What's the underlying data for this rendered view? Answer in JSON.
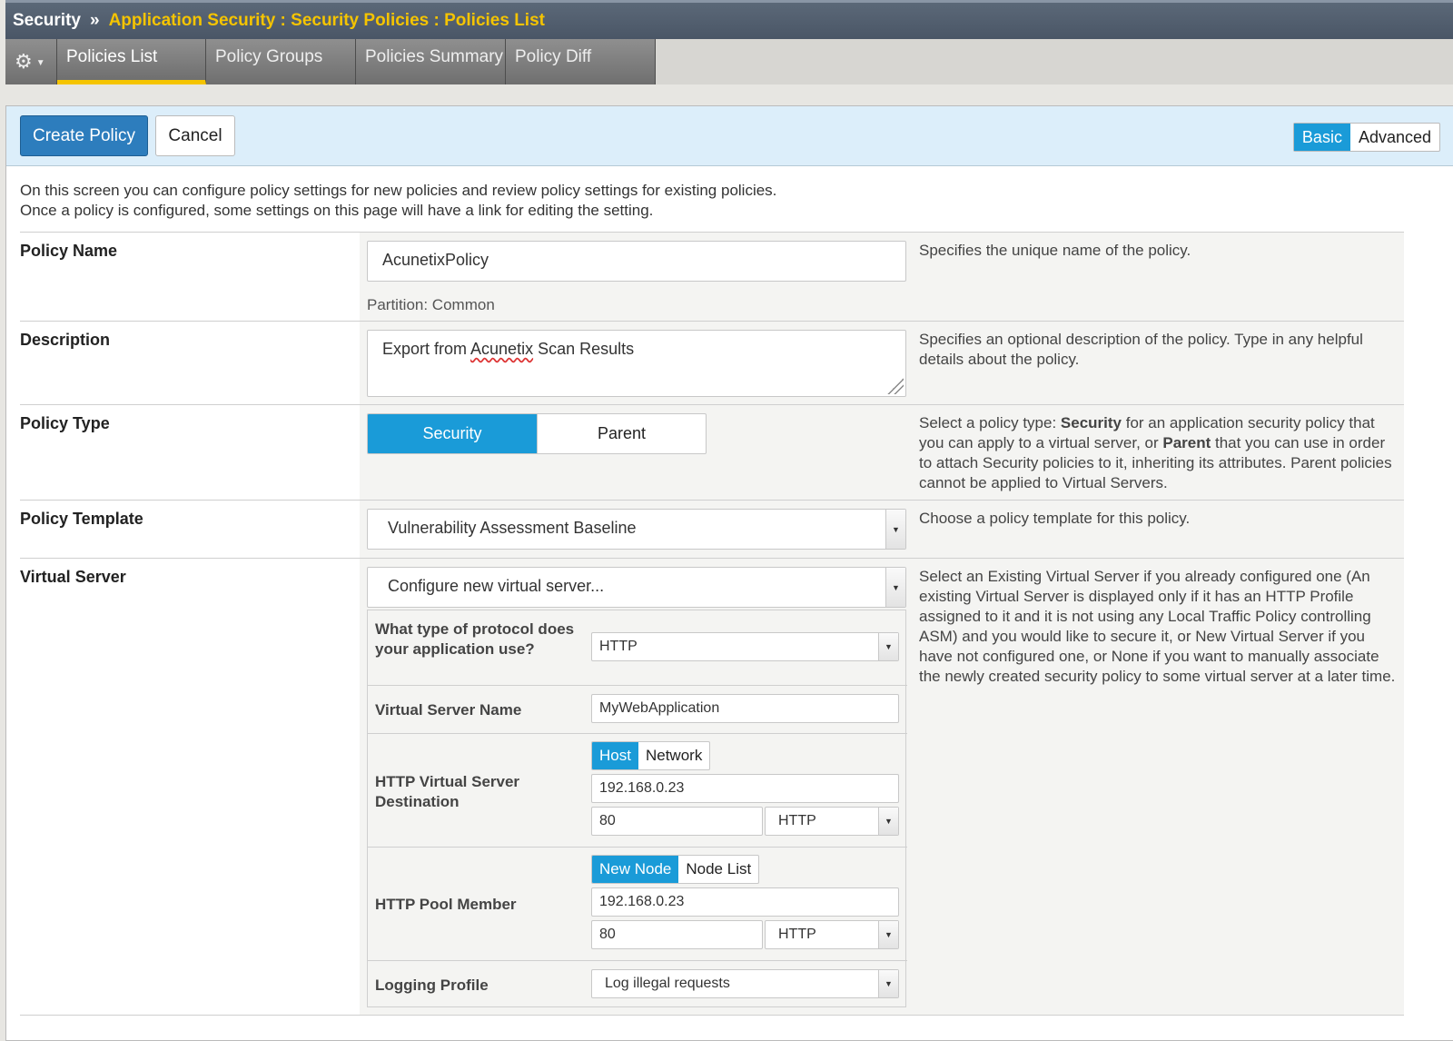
{
  "breadcrumb": {
    "root": "Security",
    "separator": "»",
    "path": "Application Security : Security Policies : Policies List"
  },
  "tabs": [
    "Policies List",
    "Policy Groups",
    "Policies Summary",
    "Policy Diff"
  ],
  "icons": {
    "gear": "gear-icon",
    "caret": "caret-down-icon"
  },
  "toolbar": {
    "create_label": "Create Policy",
    "cancel_label": "Cancel",
    "mode_basic": "Basic",
    "mode_advanced": "Advanced"
  },
  "intro": {
    "line1": "On this screen you can configure policy settings for new policies and review policy settings for existing policies.",
    "line2": "Once a policy is configured, some settings on this page will have a link for editing the setting."
  },
  "policy_name": {
    "label": "Policy Name",
    "value": "AcunetixPolicy",
    "partition": "Partition: Common",
    "help": "Specifies the unique name of the policy."
  },
  "description": {
    "label": "Description",
    "value_pre": "Export from ",
    "value_misspelled": "Acunetix",
    "value_post": " Scan Results",
    "help": "Specifies an optional description of the policy. Type in any helpful details about the policy."
  },
  "policy_type": {
    "label": "Policy Type",
    "option_security": "Security",
    "option_parent": "Parent",
    "help_1": "Select a policy type: ",
    "help_b1": "Security",
    "help_2": " for an application security policy that you can apply to a virtual server, or ",
    "help_b2": "Parent",
    "help_3": " that you can use in order to attach Security policies to it, inheriting its attributes. Parent policies cannot be applied to Virtual Servers."
  },
  "policy_template": {
    "label": "Policy Template",
    "value": "Vulnerability Assessment Baseline",
    "help": "Choose a policy template for this policy."
  },
  "virtual_server": {
    "label": "Virtual Server",
    "value": "Configure new virtual server...",
    "help": "Select an Existing Virtual Server if you already configured one (An existing Virtual Server is displayed only if it has an HTTP Profile assigned to it and it is not using any Local Traffic Policy controlling ASM) and you would like to secure it, or New Virtual Server if you have not configured one, or None if you want to manually associate the newly created security policy to some virtual server at a later time.",
    "protocol_label": "What type of protocol does your application use?",
    "protocol_value": "HTTP",
    "name_label": "Virtual Server Name",
    "name_value": "MyWebApplication",
    "dest_label": "HTTP Virtual Server Destination",
    "dest_toggle_host": "Host",
    "dest_toggle_network": "Network",
    "dest_ip": "192.168.0.23",
    "dest_port": "80",
    "dest_service": "HTTP",
    "pool_label": "HTTP Pool Member",
    "pool_toggle_new": "New Node",
    "pool_toggle_list": "Node List",
    "pool_ip": "192.168.0.23",
    "pool_port": "80",
    "pool_service": "HTTP",
    "logging_label": "Logging Profile",
    "logging_value": "Log illegal requests"
  }
}
